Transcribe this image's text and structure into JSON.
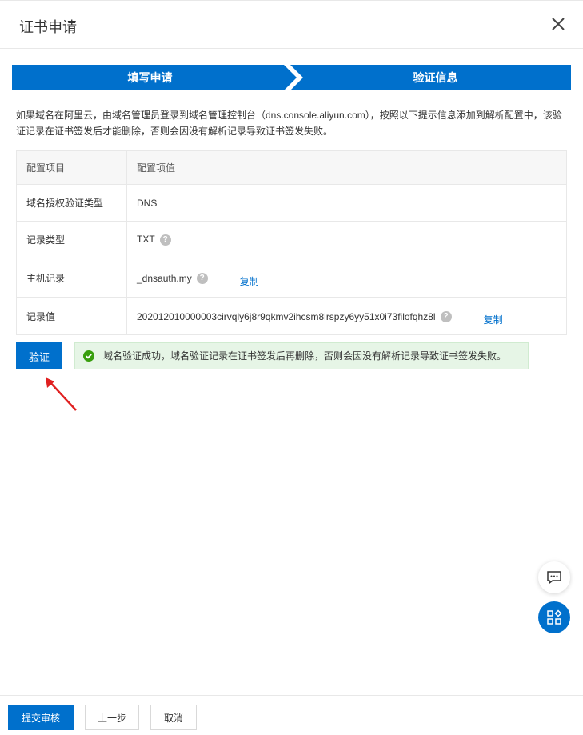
{
  "dialog": {
    "title": "证书申请"
  },
  "steps": {
    "step1": "填写申请",
    "step2": "验证信息"
  },
  "description": "如果域名在阿里云，由域名管理员登录到域名管理控制台（dns.console.aliyun.com），按照以下提示信息添加到解析配置中，该验证记录在证书签发后才能删除，否则会因没有解析记录导致证书签发失败。",
  "table": {
    "headers": [
      "配置项目",
      "配置项值"
    ],
    "rows": [
      {
        "key": "域名授权验证类型",
        "value": "DNS"
      },
      {
        "key": "记录类型",
        "value": "TXT"
      },
      {
        "key": "主机记录",
        "value": "_dnsauth.my"
      },
      {
        "key": "记录值",
        "value": "202012010000003cirvqly6j8r9qkmv2ihcsm8lrspzy6yy51x0i73filofqhz8l"
      }
    ],
    "copy_label": "复制"
  },
  "verify_button": "验证",
  "alert": {
    "message": "域名验证成功，域名验证记录在证书签发后再删除，否则会因没有解析记录导致证书签发失败。"
  },
  "footer": {
    "submit": "提交审核",
    "prev": "上一步",
    "cancel": "取消"
  },
  "colors": {
    "primary": "#0070cc",
    "success_bg": "#e6f5e6",
    "success_icon": "#389e0d",
    "annotation_arrow": "#e02020"
  }
}
